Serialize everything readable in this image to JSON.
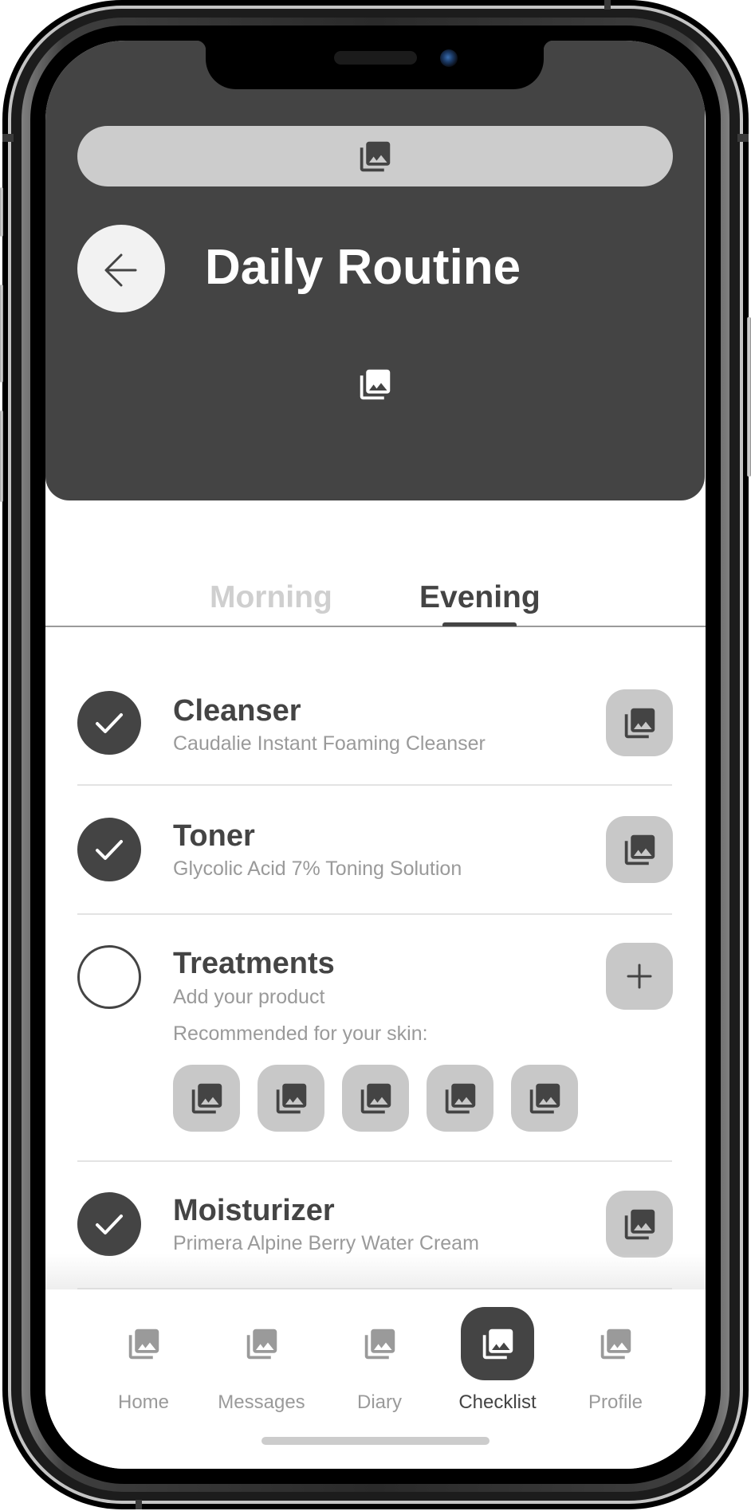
{
  "colors": {
    "header_bg": "#444444",
    "accent": "#444444",
    "chip_bg": "#c8c8c8",
    "pill_bg": "#cccccc",
    "muted_text": "#9a9a9a",
    "inactive_tab": "#cfcfcf"
  },
  "header": {
    "search_icon": "photo-library-icon",
    "back_icon": "arrow-left-icon",
    "title": "Daily Routine",
    "banner_icon": "photo-library-icon"
  },
  "tabs": [
    {
      "label": "Morning",
      "active": false
    },
    {
      "label": "Evening",
      "active": true
    }
  ],
  "routine": [
    {
      "title": "Cleanser",
      "product": "Caudalie Instant Foaming Cleanser",
      "done": true,
      "action_icon": "photo-library-icon"
    },
    {
      "title": "Toner",
      "product": "Glycolic Acid 7% Toning Solution",
      "done": true,
      "action_icon": "photo-library-icon"
    },
    {
      "title": "Treatments",
      "product": "Add your product",
      "done": false,
      "action_icon": "plus-icon",
      "recommended_label": "Recommended for your skin:",
      "recommended": [
        {
          "icon": "photo-library-icon"
        },
        {
          "icon": "photo-library-icon"
        },
        {
          "icon": "photo-library-icon"
        },
        {
          "icon": "photo-library-icon"
        },
        {
          "icon": "photo-library-icon"
        }
      ]
    },
    {
      "title": "Moisturizer",
      "product": "Primera Alpine Berry Water Cream",
      "done": true,
      "action_icon": "photo-library-icon"
    }
  ],
  "nav": [
    {
      "label": "Home",
      "icon": "photo-library-icon",
      "active": false
    },
    {
      "label": "Messages",
      "icon": "photo-library-icon",
      "active": false
    },
    {
      "label": "Diary",
      "icon": "photo-library-icon",
      "active": false
    },
    {
      "label": "Checklist",
      "icon": "photo-library-icon",
      "active": true
    },
    {
      "label": "Profile",
      "icon": "photo-library-icon",
      "active": false
    }
  ]
}
